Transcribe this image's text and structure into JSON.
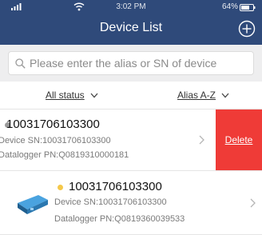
{
  "status_bar": {
    "time": "3:02 PM",
    "battery": "64%"
  },
  "header": {
    "title": "Device List"
  },
  "search": {
    "placeholder": "Please enter the alias or SN of device"
  },
  "filters": {
    "status_label": "All status",
    "sort_label": "Alias A-Z"
  },
  "devices": [
    {
      "title": "10031706103300",
      "device_sn": "Device SN:10031706103300",
      "datalogger_pn": "Datalogger PN:Q0819310000181",
      "status_color": "#9a9a9a",
      "swiped": true,
      "delete_label": "Delete"
    },
    {
      "title": "10031706103300",
      "device_sn": "Device SN:10031706103300",
      "datalogger_pn": "Datalogger PN:Q0819360039533",
      "status_color": "#f5c84a",
      "swiped": false
    }
  ],
  "colors": {
    "header_bg": "#2f4a7a",
    "delete_bg": "#ef3b37"
  }
}
